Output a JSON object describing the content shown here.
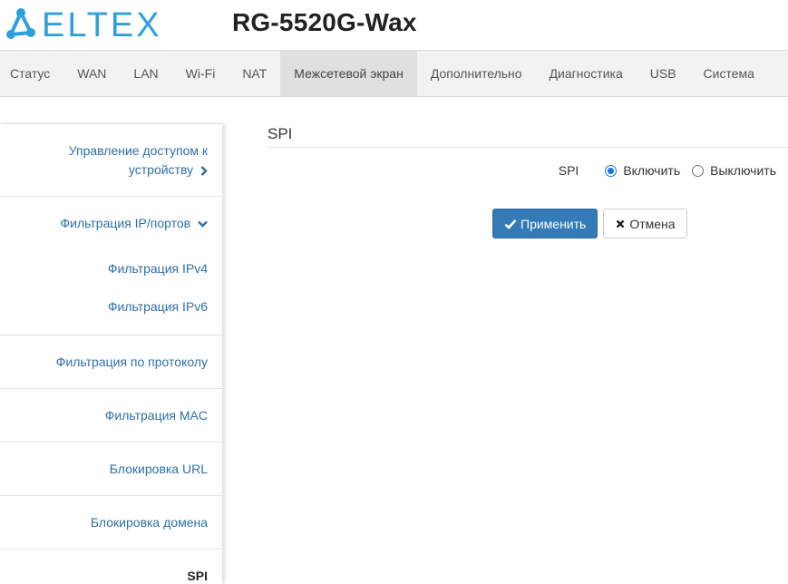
{
  "brand": {
    "logo_text": "ELTEX",
    "logo_color": "#2f9fdc"
  },
  "header": {
    "model": "RG-5520G-Wax"
  },
  "topnav": {
    "items": [
      {
        "label": "Статус"
      },
      {
        "label": "WAN"
      },
      {
        "label": "LAN"
      },
      {
        "label": "Wi-Fi"
      },
      {
        "label": "NAT"
      },
      {
        "label": "Межсетевой экран",
        "active": true
      },
      {
        "label": "Дополнительно"
      },
      {
        "label": "Диагностика"
      },
      {
        "label": "USB"
      },
      {
        "label": "Система"
      }
    ]
  },
  "sidebar": {
    "access_control": {
      "line1": "Управление доступом к",
      "line2": "устройству"
    },
    "ip_port_filter": {
      "label": "Фильтрация IP/портов"
    },
    "ipv4_filter": {
      "label": "Фильтрация IPv4"
    },
    "ipv6_filter": {
      "label": "Фильтрация IPv6"
    },
    "protocol_filter": {
      "label": "Фильтрация по протоколу"
    },
    "mac_filter": {
      "label": "Фильтрация MAC"
    },
    "url_block": {
      "label": "Блокировка URL"
    },
    "domain_block": {
      "label": "Блокировка домена"
    },
    "spi": {
      "label": "SPI"
    }
  },
  "main": {
    "title": "SPI",
    "spi_label": "SPI",
    "options": {
      "enable": "Включить",
      "disable": "Выключить",
      "selected": "enable"
    },
    "apply_label": "Применить",
    "cancel_label": "Отмена"
  },
  "colors": {
    "primary": "#337ab7",
    "link": "#2f6ea8",
    "radio": "#1a73e8"
  }
}
